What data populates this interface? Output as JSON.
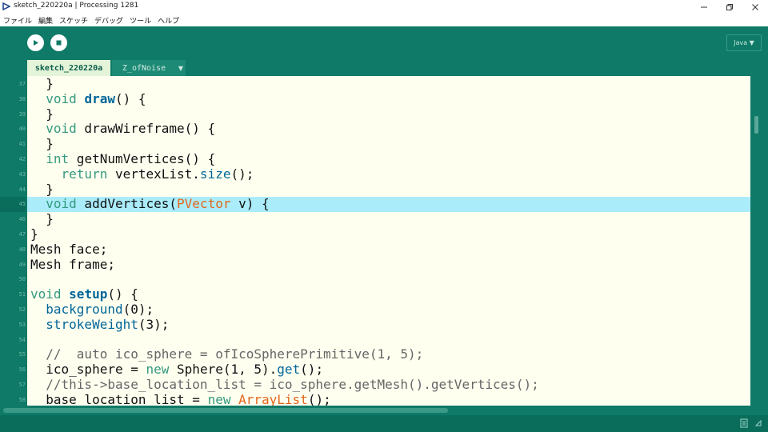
{
  "window": {
    "title": "sketch_220220a | Processing 1281",
    "minimize_icon": "minimize-icon",
    "restore_icon": "restore-icon",
    "close_icon": "close-icon"
  },
  "menu": [
    "ファイル",
    "編集",
    "スケッチ",
    "デバッグ",
    "ツール",
    "ヘルプ"
  ],
  "toolbar": {
    "run_icon": "play-icon",
    "stop_icon": "stop-icon",
    "mode_button_icon": "butterfly-icon",
    "mode_label": "Java ▼"
  },
  "tabs": [
    {
      "label": "sketch_220220a",
      "active": true
    },
    {
      "label": "Z_ofNoise",
      "active": false
    }
  ],
  "tab_menu_label": "▼",
  "editor": {
    "highlighted_line": 45,
    "lines": [
      {
        "n": "37",
        "t": "  }"
      },
      {
        "n": "38",
        "t": "  void draw() {"
      },
      {
        "n": "39",
        "t": "  }"
      },
      {
        "n": "40",
        "t": "  void drawWireframe() {"
      },
      {
        "n": "41",
        "t": "  }"
      },
      {
        "n": "42",
        "t": "  int getNumVertices() {"
      },
      {
        "n": "43",
        "t": "    return vertexList.size();"
      },
      {
        "n": "44",
        "t": "  }"
      },
      {
        "n": "45",
        "t": "  void addVertices(PVector v) {"
      },
      {
        "n": "46",
        "t": "  }"
      },
      {
        "n": "47",
        "t": "}"
      },
      {
        "n": "48",
        "t": "Mesh face;"
      },
      {
        "n": "49",
        "t": "Mesh frame;"
      },
      {
        "n": "50",
        "t": ""
      },
      {
        "n": "51",
        "t": "void setup() {"
      },
      {
        "n": "52",
        "t": "  background(0);"
      },
      {
        "n": "53",
        "t": "  strokeWeight(3);"
      },
      {
        "n": "54",
        "t": ""
      },
      {
        "n": "55",
        "t": "  //  auto ico_sphere = ofIcoSpherePrimitive(1, 5);"
      },
      {
        "n": "56",
        "t": "  ico_sphere = new Sphere(1, 5).get();"
      },
      {
        "n": "57",
        "t": "  //this->base_location_list = ico_sphere.getMesh().getVertices();"
      },
      {
        "n": "58",
        "t": "  base_location_list = new ArrayList();"
      }
    ]
  },
  "status": {
    "console_icon": "console-icon",
    "arrow_icon": "resize-arrow-icon"
  },
  "colors": {
    "background": "#0e7a67",
    "editor_bg": "#fffff0",
    "highlight": "#abecfa",
    "keyword": "#33997e",
    "function": "#006699",
    "type": "#e2661a",
    "comment": "#666666"
  }
}
